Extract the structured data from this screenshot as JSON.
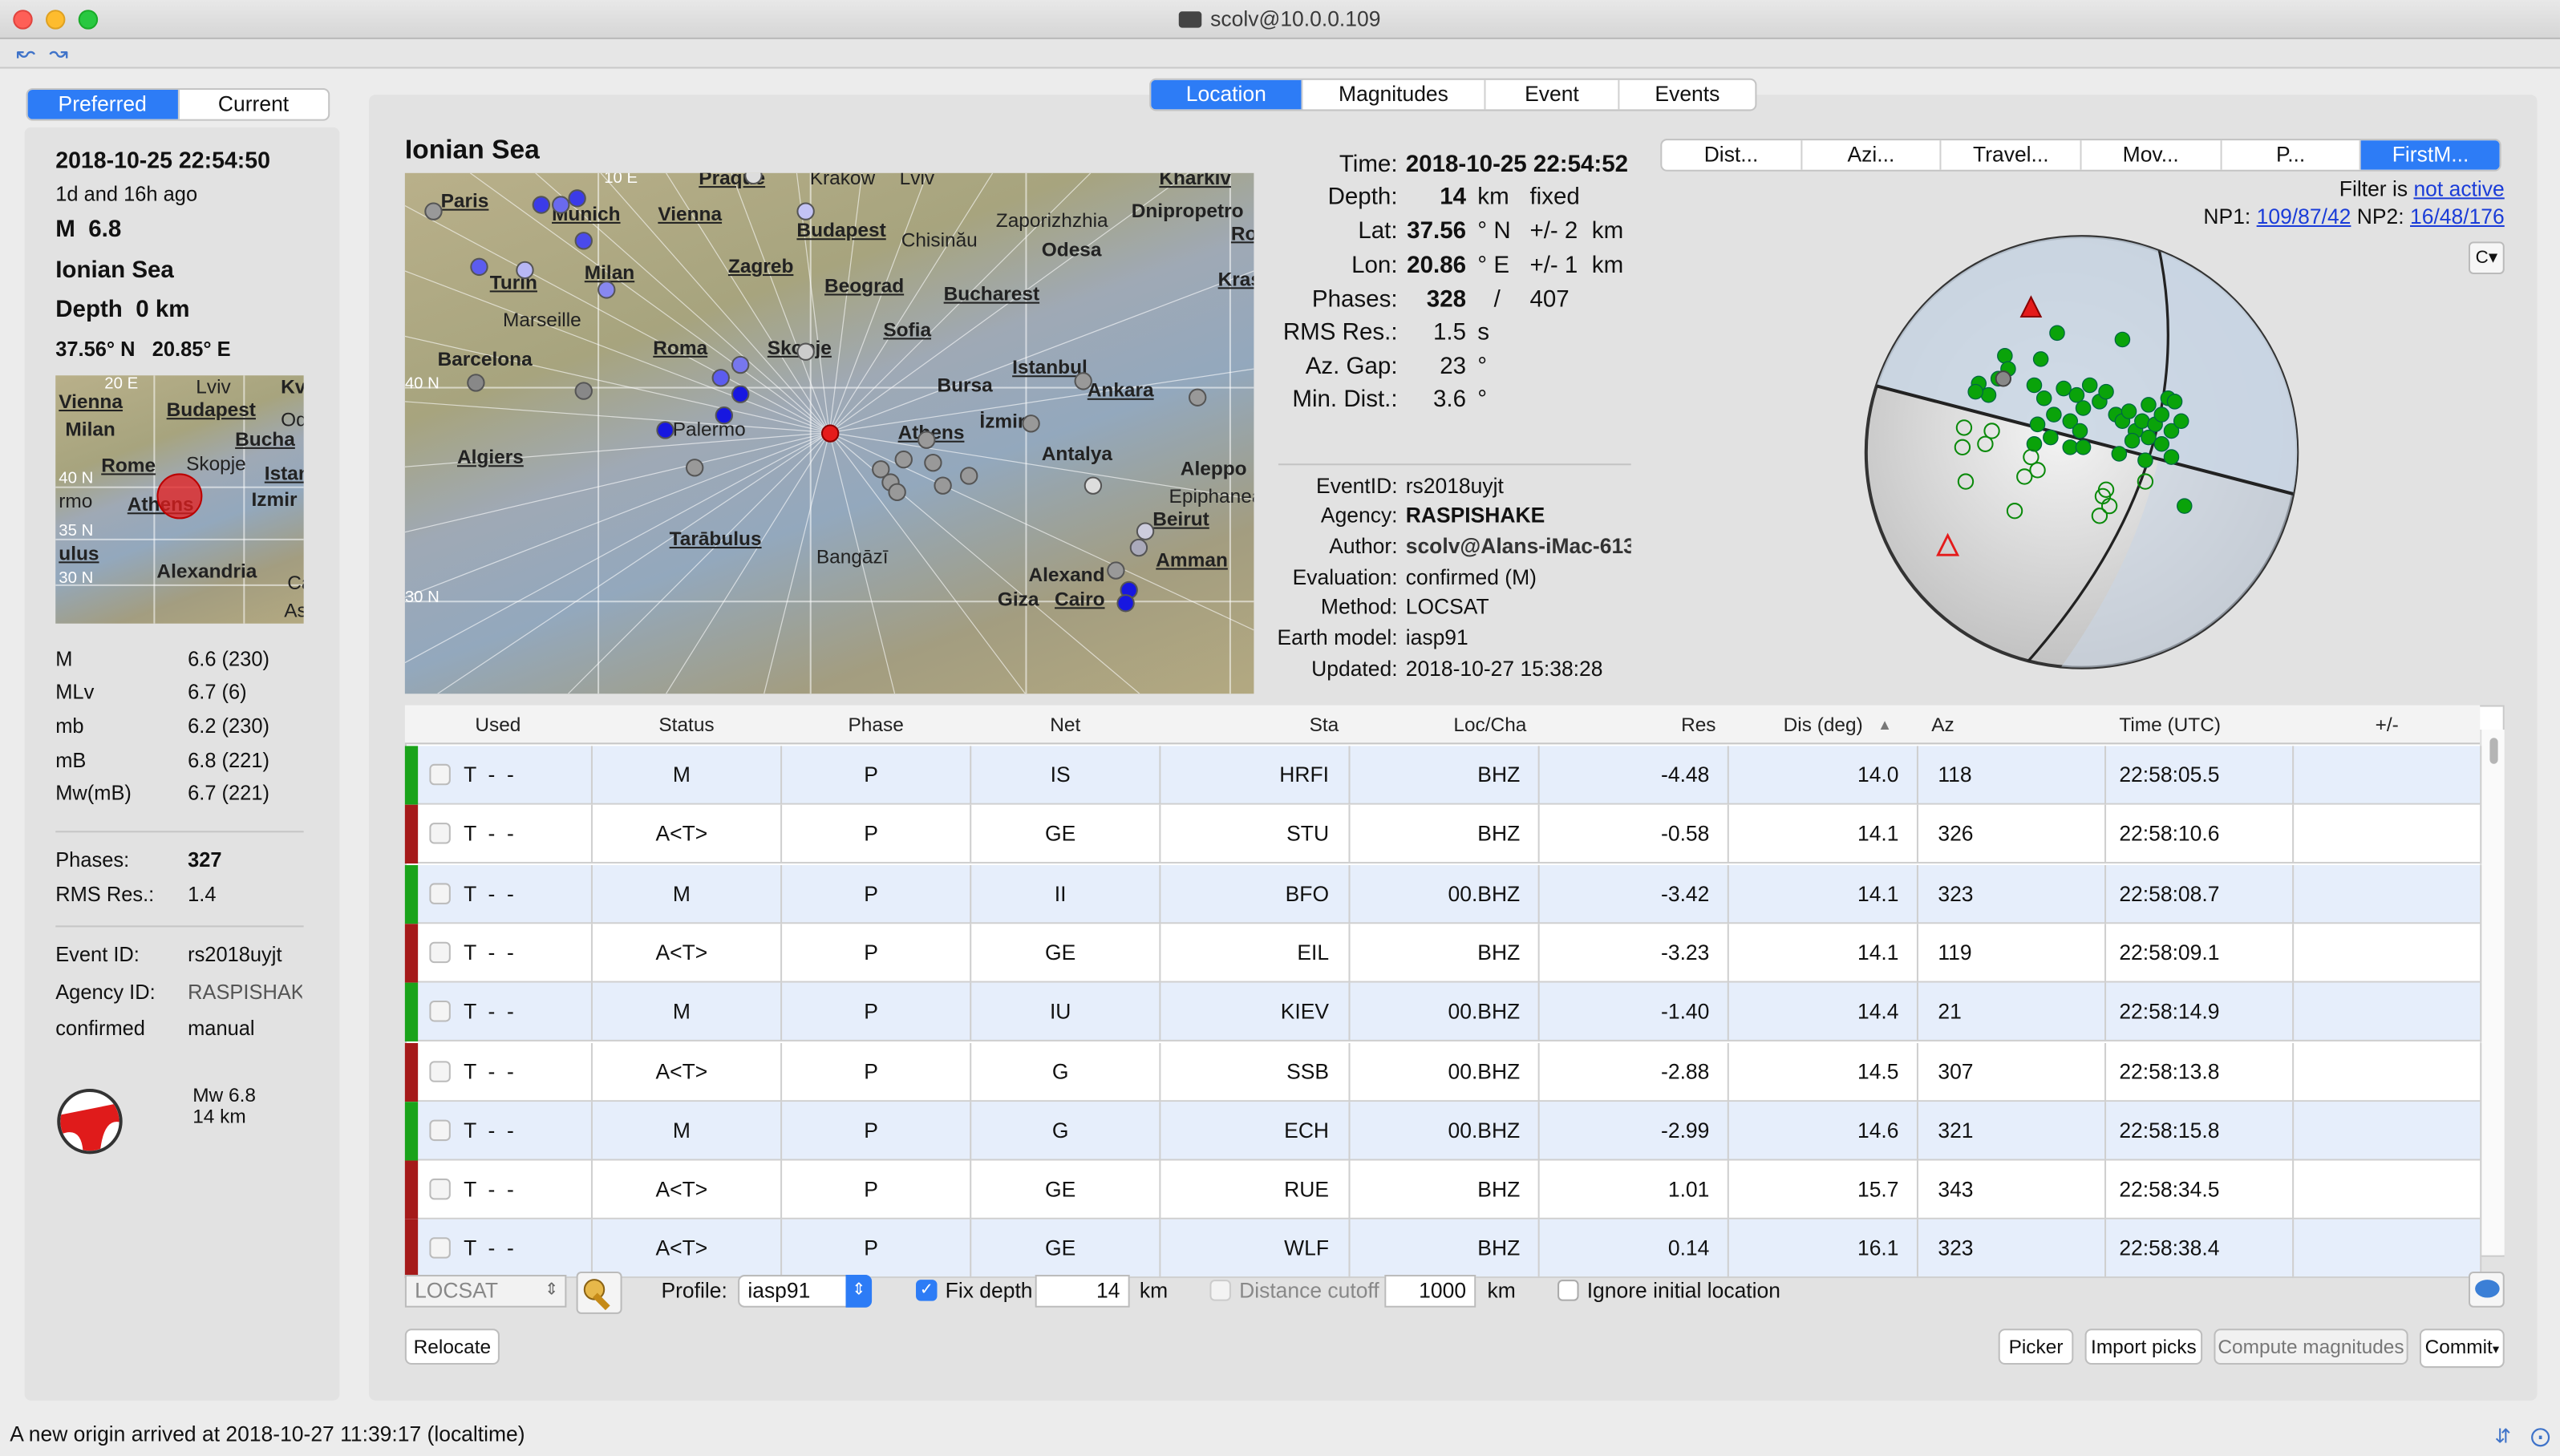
{
  "window": {
    "title": "scolv@10.0.0.109"
  },
  "left": {
    "tab_preferred": "Preferred",
    "tab_current": "Current",
    "datetime": "2018-10-25 22:54:50",
    "ago": "1d and 16h ago",
    "mag": "M  6.8",
    "region": "Ionian Sea",
    "depth": "Depth  0 km",
    "coords": "37.56° N   20.85° E",
    "mags": [
      {
        "type": "M",
        "val": "6.6 (230)"
      },
      {
        "type": "MLv",
        "val": "6.7 (6)"
      },
      {
        "type": "mb",
        "val": "6.2 (230)"
      },
      {
        "type": "mB",
        "val": "6.8 (221)"
      },
      {
        "type": "Mw(mB)",
        "val": "6.7 (221)"
      }
    ],
    "phases_label": "Phases:",
    "phases": "327",
    "rms_label": "RMS Res.:",
    "rms": "1.4",
    "eventid_label": "Event ID:",
    "eventid": "rs2018uyjt",
    "agency_label": "Agency ID:",
    "agency": "RASPISHAK",
    "status": "confirmed",
    "mode": "manual",
    "fm_mag": "Mw 6.8",
    "fm_depth": "14 km",
    "mini_map_labels": [
      "Vienna",
      "Budapest",
      "Milan",
      "Rome",
      "Skopje",
      "Bucha",
      "Istan",
      "Athens",
      "Izmir",
      "Alexandria",
      "Lviv",
      "Od",
      "rmo",
      "ulus",
      "As",
      "Ca",
      "40 N",
      "35 N",
      "30 N",
      "20 E",
      "Kv"
    ]
  },
  "tabs": [
    "Location",
    "Magnitudes",
    "Event",
    "Events"
  ],
  "region_title": "Ionian Sea",
  "map_labels": [
    "Paris",
    "Munich",
    "Vienna",
    "Praque",
    "Krakow",
    "Lviv",
    "Kharkiv",
    "Dnipropetro",
    "Budapest",
    "Zaporizhzhia",
    "Chisinău",
    "Odesa",
    "Zagreb",
    "Beograd",
    "Bucharest",
    "Milan",
    "Marseille",
    "Roma",
    "Skopje",
    "Sofia",
    "Barcelona",
    "Istanbul",
    "Bursa",
    "Ankara",
    "İzmir",
    "Athens",
    "Antalya",
    "Palermo",
    "Algiers",
    "Aleppo",
    "Epiphanea",
    "Beirut",
    "Tarābulus",
    "Bangāzī",
    "Alexand",
    "Amman",
    "Giza",
    "Cairo",
    "Ro",
    "Kras",
    "40 N",
    "30 N",
    "10 E",
    "Turin"
  ],
  "location": {
    "time_l": "Time:",
    "time": "2018-10-25 22:54:52",
    "depth_l": "Depth:",
    "depth": "14",
    "depth_u": "km",
    "depth_fix": "fixed",
    "lat_l": "Lat:",
    "lat": "37.56",
    "lat_u": "° N",
    "lat_err": "+/- 2",
    "lat_eu": "km",
    "lon_l": "Lon:",
    "lon": "20.86",
    "lon_u": "° E",
    "lon_err": "+/- 1",
    "lon_eu": "km",
    "phases_l": "Phases:",
    "phases": "328",
    "phases_sep": "/",
    "phases_tot": "407",
    "rms_l": "RMS Res.:",
    "rms": "1.5",
    "rms_u": "s",
    "gap_l": "Az. Gap:",
    "gap": "23",
    "gap_u": "°",
    "mind_l": "Min. Dist.:",
    "mind": "3.6",
    "mind_u": "°",
    "eventid_l": "EventID:",
    "eventid": "rs2018uyjt",
    "agency_l": "Agency:",
    "agency": "RASPISHAKE",
    "author_l": "Author:",
    "author": "scolv@Alans-iMac-613",
    "eval_l": "Evaluation:",
    "eval": "confirmed (M)",
    "method_l": "Method:",
    "method": "LOCSAT",
    "earth_l": "Earth model:",
    "earth": "iasp91",
    "upd_l": "Updated:",
    "updated": "2018-10-27 15:38:28"
  },
  "plot_tabs": [
    "Dist...",
    "Azi...",
    "Travel...",
    "Mov...",
    "P...",
    "FirstM..."
  ],
  "filter": {
    "text": "Filter is",
    "link": "not active"
  },
  "np": {
    "np1_l": "NP1:",
    "np1": "109/87/42",
    "np2_l": "NP2:",
    "np2": "16/48/176"
  },
  "table": {
    "headers": [
      "Used",
      "Status",
      "Phase",
      "Net",
      "Sta",
      "Loc/Cha",
      "Res",
      "Dis (deg)",
      "Az",
      "Time (UTC)",
      "+/-"
    ],
    "rows": [
      {
        "used": "T  -  -",
        "status": "M",
        "phase": "P",
        "net": "IS",
        "sta": "HRFI",
        "loc": "BHZ",
        "res": "-4.48",
        "dis": "14.0",
        "az": "118",
        "time": "22:58:05.5",
        "c": "#1aa31a"
      },
      {
        "used": "T  -  -",
        "status": "A<T>",
        "phase": "P",
        "net": "GE",
        "sta": "STU",
        "loc": "BHZ",
        "res": "-0.58",
        "dis": "14.1",
        "az": "326",
        "time": "22:58:10.6",
        "c": "#a51a1a"
      },
      {
        "used": "T  -  -",
        "status": "M",
        "phase": "P",
        "net": "II",
        "sta": "BFO",
        "loc": "00.BHZ",
        "res": "-3.42",
        "dis": "14.1",
        "az": "323",
        "time": "22:58:08.7",
        "c": "#1aa31a"
      },
      {
        "used": "T  -  -",
        "status": "A<T>",
        "phase": "P",
        "net": "GE",
        "sta": "EIL",
        "loc": "BHZ",
        "res": "-3.23",
        "dis": "14.1",
        "az": "119",
        "time": "22:58:09.1",
        "c": "#a51a1a"
      },
      {
        "used": "T  -  -",
        "status": "M",
        "phase": "P",
        "net": "IU",
        "sta": "KIEV",
        "loc": "00.BHZ",
        "res": "-1.40",
        "dis": "14.4",
        "az": "21",
        "time": "22:58:14.9",
        "c": "#1aa31a"
      },
      {
        "used": "T  -  -",
        "status": "A<T>",
        "phase": "P",
        "net": "G",
        "sta": "SSB",
        "loc": "00.BHZ",
        "res": "-2.88",
        "dis": "14.5",
        "az": "307",
        "time": "22:58:13.8",
        "c": "#a51a1a"
      },
      {
        "used": "T  -  -",
        "status": "M",
        "phase": "P",
        "net": "G",
        "sta": "ECH",
        "loc": "00.BHZ",
        "res": "-2.99",
        "dis": "14.6",
        "az": "321",
        "time": "22:58:15.8",
        "c": "#1aa31a"
      },
      {
        "used": "T  -  -",
        "status": "A<T>",
        "phase": "P",
        "net": "GE",
        "sta": "RUE",
        "loc": "BHZ",
        "res": "1.01",
        "dis": "15.7",
        "az": "343",
        "time": "22:58:34.5",
        "c": "#a51a1a"
      },
      {
        "used": "T  -  -",
        "status": "A<T>",
        "phase": "P",
        "net": "GE",
        "sta": "WLF",
        "loc": "BHZ",
        "res": "0.14",
        "dis": "16.1",
        "az": "323",
        "time": "22:58:38.4",
        "c": "#a51a1a"
      }
    ]
  },
  "controls": {
    "locator": "LOCSAT",
    "profile_l": "Profile:",
    "profile": "iasp91",
    "fixdepth": "Fix depth",
    "fixdepth_val": "14",
    "km1": "km",
    "distcut": "Distance cutoff",
    "distcut_val": "1000",
    "km2": "km",
    "ignore": "Ignore initial location",
    "relocate": "Relocate",
    "picker": "Picker",
    "import": "Import picks",
    "compute": "Compute magnitudes",
    "commit": "Commit"
  },
  "status_bar": "A new origin arrived at 2018-10-27 11:39:17 (localtime)"
}
